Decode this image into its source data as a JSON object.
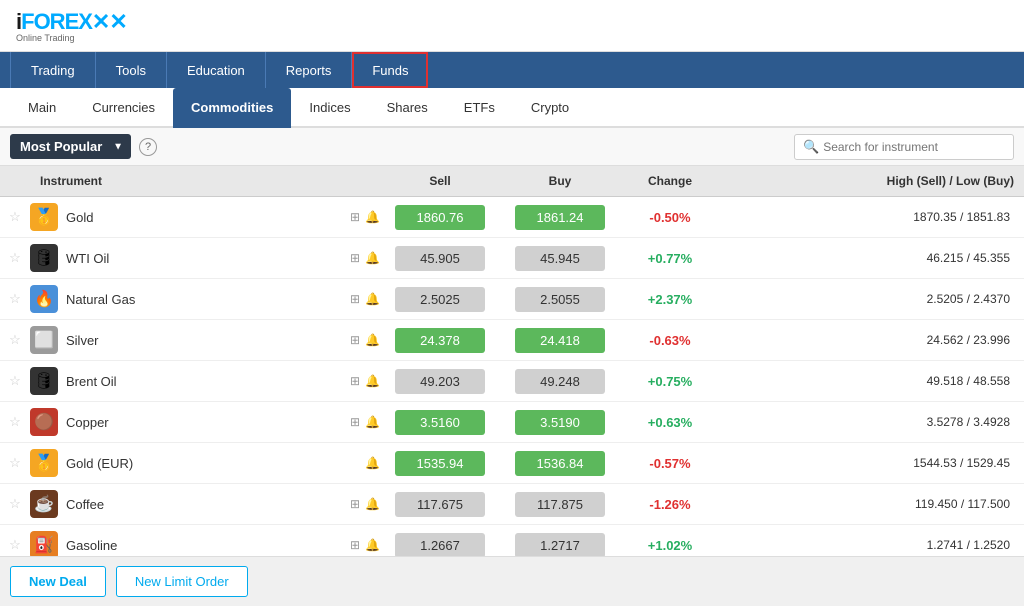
{
  "logo": {
    "main": "iFOREX",
    "sub": "Online Trading"
  },
  "navbar": {
    "items": [
      {
        "label": "Trading",
        "active": false
      },
      {
        "label": "Tools",
        "active": false
      },
      {
        "label": "Education",
        "active": false
      },
      {
        "label": "Reports",
        "active": false
      },
      {
        "label": "Funds",
        "active": true,
        "highlighted": true
      }
    ]
  },
  "tabs": [
    {
      "label": "Main",
      "active": false
    },
    {
      "label": "Currencies",
      "active": false
    },
    {
      "label": "Commodities",
      "active": true
    },
    {
      "label": "Indices",
      "active": false
    },
    {
      "label": "Shares",
      "active": false
    },
    {
      "label": "ETFs",
      "active": false
    },
    {
      "label": "Crypto",
      "active": false
    }
  ],
  "filter": {
    "dropdown": "Most Popular",
    "search_placeholder": "Search for instrument"
  },
  "table": {
    "headers": [
      "",
      "Instrument",
      "Sell",
      "Buy",
      "Change",
      "High (Sell) / Low (Buy)"
    ],
    "rows": [
      {
        "name": "Gold",
        "icon": "🥇",
        "icon_class": "icon-gold",
        "sell": "1860.76",
        "buy": "1861.24",
        "change": "-0.50%",
        "change_type": "neg",
        "high_low": "1870.35 / 1851.83",
        "sell_highlight": true,
        "buy_highlight": true
      },
      {
        "name": "WTI Oil",
        "icon": "🛢",
        "icon_class": "icon-oil",
        "sell": "45.905",
        "buy": "45.945",
        "change": "+0.77%",
        "change_type": "pos",
        "high_low": "46.215 / 45.355",
        "sell_highlight": false,
        "buy_highlight": false
      },
      {
        "name": "Natural Gas",
        "icon": "🔥",
        "icon_class": "icon-gas",
        "sell": "2.5025",
        "buy": "2.5055",
        "change": "+2.37%",
        "change_type": "pos",
        "high_low": "2.5205 / 2.4370",
        "sell_highlight": false,
        "buy_highlight": false
      },
      {
        "name": "Silver",
        "icon": "⬜",
        "icon_class": "icon-silver",
        "sell": "24.378",
        "buy": "24.418",
        "change": "-0.63%",
        "change_type": "neg",
        "high_low": "24.562 / 23.996",
        "sell_highlight": true,
        "buy_highlight": true
      },
      {
        "name": "Brent Oil",
        "icon": "🛢",
        "icon_class": "icon-oil",
        "sell": "49.203",
        "buy": "49.248",
        "change": "+0.75%",
        "change_type": "pos",
        "high_low": "49.518 / 48.558",
        "sell_highlight": false,
        "buy_highlight": false
      },
      {
        "name": "Copper",
        "icon": "🟤",
        "icon_class": "icon-copper",
        "sell": "3.5160",
        "buy": "3.5190",
        "change": "+0.63%",
        "change_type": "pos",
        "high_low": "3.5278 / 3.4928",
        "sell_highlight": true,
        "buy_highlight": true
      },
      {
        "name": "Gold (EUR)",
        "icon": "🥇",
        "icon_class": "icon-gold",
        "sell": "1535.94",
        "buy": "1536.84",
        "change": "-0.57%",
        "change_type": "neg",
        "high_low": "1544.53 / 1529.45",
        "sell_highlight": true,
        "buy_highlight": true,
        "no_external": true
      },
      {
        "name": "Coffee",
        "icon": "☕",
        "icon_class": "icon-coffee",
        "sell": "117.675",
        "buy": "117.875",
        "change": "-1.26%",
        "change_type": "neg",
        "high_low": "119.450 / 117.500",
        "sell_highlight": false,
        "buy_highlight": false
      },
      {
        "name": "Gasoline",
        "icon": "⛽",
        "icon_class": "icon-gasoline",
        "sell": "1.2667",
        "buy": "1.2717",
        "change": "+1.02%",
        "change_type": "pos",
        "high_low": "1.2741 / 1.2520",
        "sell_highlight": false,
        "buy_highlight": false
      }
    ]
  },
  "bottom": {
    "new_deal": "New Deal",
    "new_limit": "New Limit Order"
  }
}
